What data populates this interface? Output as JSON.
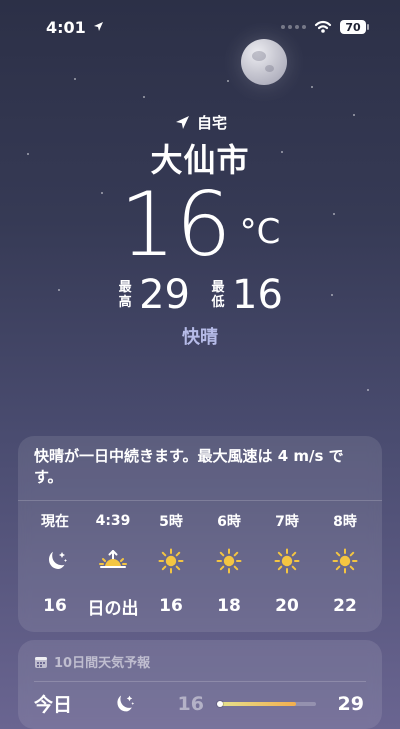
{
  "status": {
    "time": "4:01",
    "battery": "70"
  },
  "location": {
    "name": "自宅",
    "city": "大仙市"
  },
  "weather": {
    "current_temp": "16",
    "unit": "°C",
    "high_label": "最高",
    "high": "29",
    "low_label": "最低",
    "low": "16",
    "condition": "快晴"
  },
  "forecast": {
    "summary": "快晴が一日中続きます。最大風速は 4 m/s です。",
    "hours": [
      {
        "time": "現在",
        "icon": "moon-stars-icon",
        "temp": "16"
      },
      {
        "time": "4:39",
        "icon": "sunrise-icon",
        "temp": "日の出"
      },
      {
        "time": "5時",
        "icon": "sun-icon",
        "temp": "16"
      },
      {
        "time": "6時",
        "icon": "sun-icon",
        "temp": "18"
      },
      {
        "time": "7時",
        "icon": "sun-icon",
        "temp": "20"
      },
      {
        "time": "8時",
        "icon": "sun-icon",
        "temp": "22"
      }
    ]
  },
  "ten_day": {
    "title": "10日間天気予報",
    "today": {
      "label": "今日",
      "icon": "moon-stars-icon",
      "low": "16",
      "high": "29"
    }
  },
  "colors": {
    "condition": "#b6bbe8",
    "sun": "#f4c542",
    "range_start": "#e5e38e",
    "range_end": "#f3ae4e"
  }
}
